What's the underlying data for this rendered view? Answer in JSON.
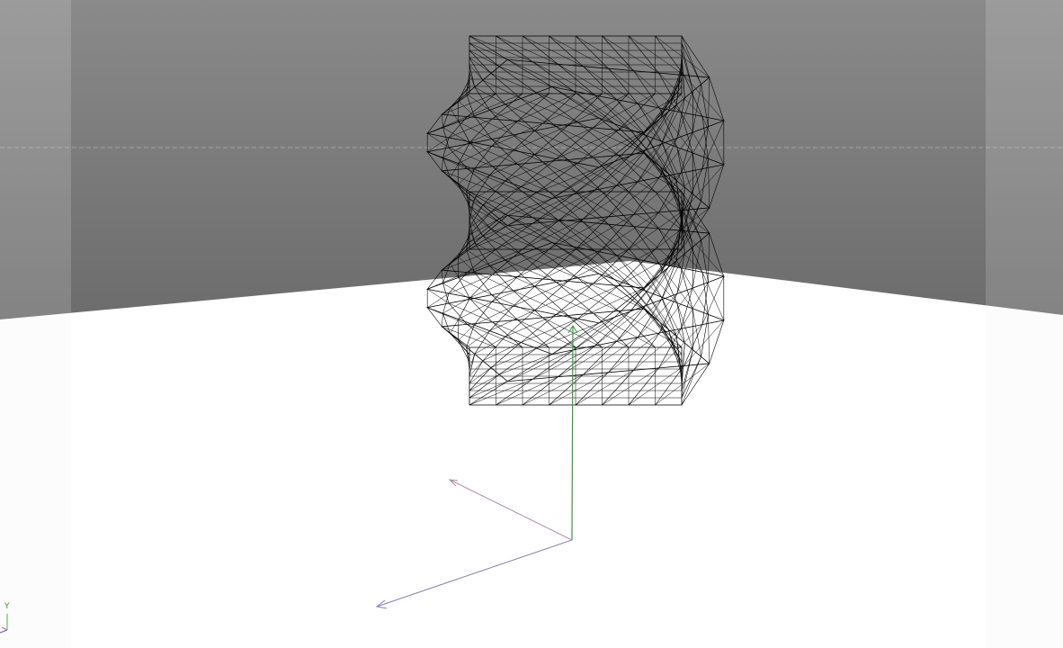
{
  "viewport": {
    "sky_color": "#8a8a8a",
    "floor_color": "#ffffff",
    "margin_color": "#f1f1f1",
    "horizon_guide_color": "#b0b0b0"
  },
  "model": {
    "shape": "twisted-box-wireframe",
    "twist_turns_deg": 180,
    "vertical_divisions": 10,
    "horizontal_divisions": 8,
    "stroke_color": "#000000"
  },
  "world_axes": {
    "x_color": "#8a7cb6",
    "y_color": "#33a033",
    "z_color": "#b08aa8"
  },
  "corner_gizmo": {
    "y_label": "Y",
    "x_color": "#3333cc",
    "y_color": "#22aa22",
    "z_color": "#cc33cc"
  }
}
